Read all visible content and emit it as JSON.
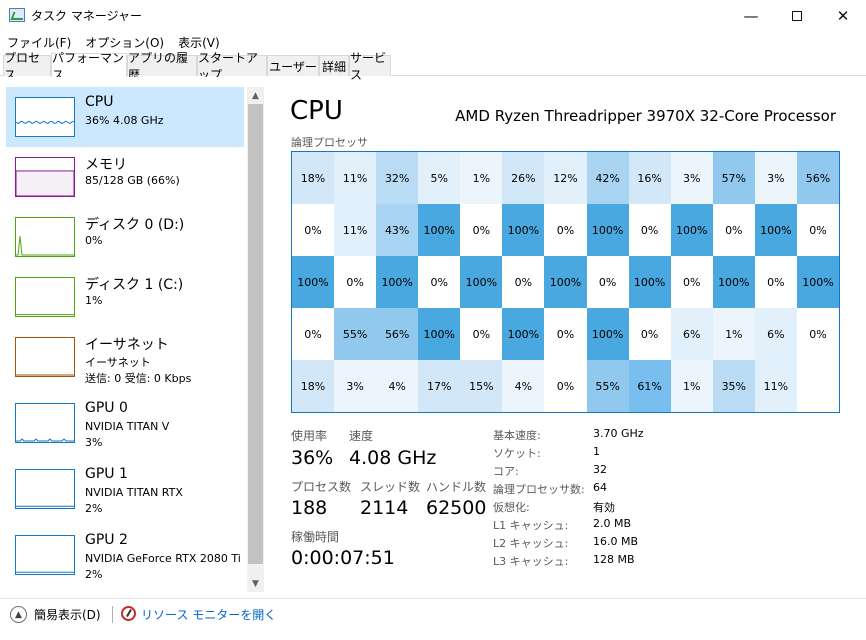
{
  "window": {
    "title": "タスク マネージャー",
    "minimize": "—",
    "close": "✕"
  },
  "menu": [
    "ファイル(F)",
    "オプション(O)",
    "表示(V)"
  ],
  "tabs": [
    {
      "label": "プロセス",
      "active": false
    },
    {
      "label": "パフォーマンス",
      "active": true
    },
    {
      "label": "アプリの履歴",
      "active": false
    },
    {
      "label": "スタートアップ",
      "active": false
    },
    {
      "label": "ユーザー",
      "active": false
    },
    {
      "label": "詳細",
      "active": false
    },
    {
      "label": "サービス",
      "active": false
    }
  ],
  "sidebar": [
    {
      "name": "CPU",
      "lines": [
        "36%  4.08 GHz"
      ],
      "color": "#1379c9",
      "selected": true,
      "level": 0.36
    },
    {
      "name": "メモリ",
      "lines": [
        "85/128 GB (66%)"
      ],
      "color": "#8b1a9b",
      "selected": false,
      "level": 0.66
    },
    {
      "name": "ディスク 0 (D:)",
      "lines": [
        "0%"
      ],
      "color": "#4da60c",
      "selected": false,
      "level": 0.0
    },
    {
      "name": "ディスク 1 (C:)",
      "lines": [
        "1%"
      ],
      "color": "#4da60c",
      "selected": false,
      "level": 0.01
    },
    {
      "name": "イーサネット",
      "lines": [
        "イーサネット",
        "送信: 0  受信: 0 Kbps"
      ],
      "color": "#a7530c",
      "selected": false,
      "level": 0.0
    },
    {
      "name": "GPU 0",
      "lines": [
        "NVIDIA TITAN V",
        "3%"
      ],
      "color": "#1379c9",
      "selected": false,
      "level": 0.03
    },
    {
      "name": "GPU 1",
      "lines": [
        "NVIDIA TITAN RTX",
        "2%"
      ],
      "color": "#1379c9",
      "selected": false,
      "level": 0.02
    },
    {
      "name": "GPU 2",
      "lines": [
        "NVIDIA GeForce RTX 2080 Ti",
        "2%"
      ],
      "color": "#1379c9",
      "selected": false,
      "level": 0.02
    }
  ],
  "main": {
    "title": "CPU",
    "model": "AMD Ryzen Threadripper 3970X 32-Core Processor",
    "lp_label": "論理プロセッサ",
    "grid": [
      [
        18,
        11,
        32,
        5,
        1,
        26,
        12,
        42,
        16,
        3,
        57,
        3,
        56
      ],
      [
        0,
        11,
        43,
        100,
        0,
        100,
        0,
        100,
        0,
        100,
        0,
        100,
        0
      ],
      [
        100,
        0,
        100,
        0,
        100,
        0,
        100,
        0,
        100,
        0,
        100,
        0,
        100
      ],
      [
        0,
        55,
        56,
        100,
        0,
        100,
        0,
        100,
        0,
        6,
        1,
        6,
        0
      ],
      [
        18,
        3,
        4,
        17,
        15,
        4,
        0,
        55,
        61,
        1,
        35,
        11,
        null
      ]
    ],
    "stats": {
      "usage_label": "使用率",
      "usage": "36%",
      "speed_label": "速度",
      "speed": "4.08 GHz",
      "proc_label": "プロセス数",
      "proc": "188",
      "threads_label": "スレッド数",
      "threads": "2114",
      "handles_label": "ハンドル数",
      "handles": "62500",
      "uptime_label": "稼働時間",
      "uptime": "0:00:07:51"
    },
    "specs": [
      {
        "label": "基本速度:",
        "value": "3.70 GHz"
      },
      {
        "label": "ソケット:",
        "value": "1"
      },
      {
        "label": "コア:",
        "value": "32"
      },
      {
        "label": "論理プロセッサ数:",
        "value": "64"
      },
      {
        "label": "仮想化:",
        "value": "有効"
      },
      {
        "label": "L1 キャッシュ:",
        "value": "2.0 MB"
      },
      {
        "label": "L2 キャッシュ:",
        "value": "16.0 MB"
      },
      {
        "label": "L3 キャッシュ:",
        "value": "128 MB"
      }
    ]
  },
  "footer": {
    "fewer": "簡易表示(D)",
    "resmon": "リソース モニターを開く"
  }
}
